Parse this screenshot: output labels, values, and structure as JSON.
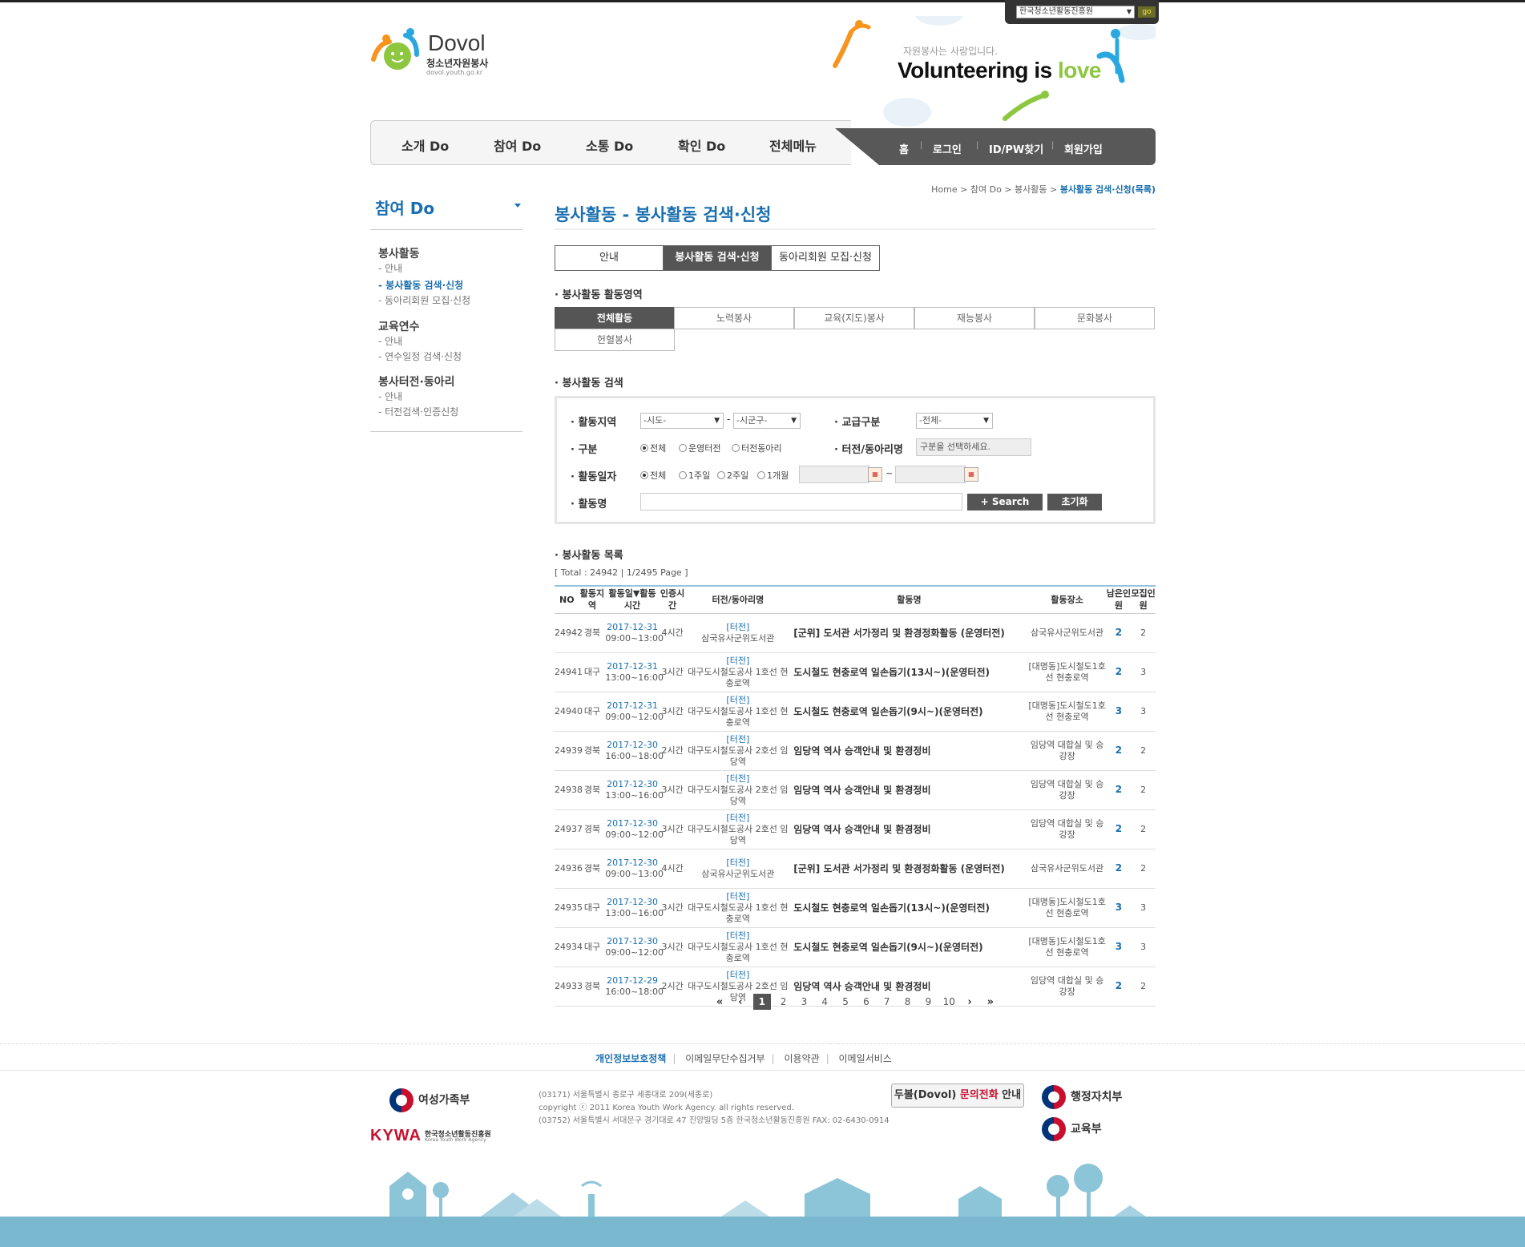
{
  "header": {
    "logo_title": "Dovol",
    "logo_subtitle": "청소년자원봉사",
    "logo_url": "dovol.youth.go.kr",
    "site_select": "한국청소년활동진흥원",
    "go_label": "go",
    "slogan_small": "자원봉사는 사랑입니다.",
    "slogan_main": "Volunteering is ",
    "slogan_love": "love"
  },
  "nav": {
    "items": [
      "소개 Do",
      "참여 Do",
      "소통 Do",
      "확인 Do",
      "전체메뉴"
    ],
    "utils": [
      "홈",
      "로그인",
      "ID/PW찾기",
      "회원가입"
    ]
  },
  "sidebar": {
    "title": "참여 Do",
    "groups": [
      {
        "label": "봉사활동",
        "items": [
          "- 안내",
          "- 봉사활동 검색·신청",
          "- 동아리회원 모집·신청"
        ]
      },
      {
        "label": "교육연수",
        "items": [
          "- 안내",
          "- 연수일정 검색·신청"
        ]
      },
      {
        "label": "봉사터전·동아리",
        "items": [
          "- 안내",
          "- 터전검색·인증신청"
        ]
      }
    ]
  },
  "breadcrumb": {
    "items": [
      "Home",
      "참여 Do",
      "봉사활동"
    ],
    "current": "봉사활동 검색·신청(목록)"
  },
  "page_title": "봉사활동 - 봉사활동 검색·신청",
  "tabs": [
    "안내",
    "봉사활동 검색·신청",
    "동아리회원 모집·신청"
  ],
  "area_section": {
    "title": "봉사활동 활동영역",
    "areas": [
      "전체활동",
      "노력봉사",
      "교육(지도)봉사",
      "재능봉사",
      "문화봉사",
      "헌혈봉사"
    ]
  },
  "search": {
    "title": "봉사활동 검색",
    "region_label": "활동지역",
    "sido": "-시도-",
    "sigungu": "-시군구-",
    "school_label": "교급구분",
    "school_value": "-전체-",
    "type_label": "구분",
    "type_options": [
      "전체",
      "운영터전",
      "터전동아리"
    ],
    "org_label": "터전/동아리명",
    "org_placeholder": "구분을 선택하세요.",
    "date_label": "활동일자",
    "date_options": [
      "전체",
      "1주일",
      "2주일",
      "1개월"
    ],
    "name_label": "활동명",
    "search_button": "+ Search",
    "reset_button": "초기화"
  },
  "list": {
    "title": "봉사활동 목록",
    "total": "[ Total : 24942    |    1/2495 Page ]",
    "headers": {
      "no": "NO",
      "region": "활동지역",
      "date": "활동일▼활동시간",
      "hours": "인증시간",
      "org": "터전/동아리명",
      "name": "활동명",
      "place": "활동장소",
      "remain": "남은인원",
      "recruit": "모집인원"
    },
    "rows": [
      {
        "no": "24942",
        "region": "경북",
        "date": "2017-12-31",
        "time": "09:00~13:00",
        "hours": "4시간",
        "tag": "[터전]",
        "org": "삼국유사군위도서관",
        "name": "[군위] 도서관 서가정리 및 환경정화활동 (운영터전)",
        "place": "삼국유사군위도서관",
        "remain": "2",
        "recruit": "2"
      },
      {
        "no": "24941",
        "region": "대구",
        "date": "2017-12-31",
        "time": "13:00~16:00",
        "hours": "3시간",
        "tag": "[터전]",
        "org": "대구도시철도공사 1호선 현충로역",
        "name": "도시철도 현충로역 일손돕기(13시~)(운영터전)",
        "place": "[대명동]도시철도1호선 현충로역",
        "remain": "2",
        "recruit": "3"
      },
      {
        "no": "24940",
        "region": "대구",
        "date": "2017-12-31",
        "time": "09:00~12:00",
        "hours": "3시간",
        "tag": "[터전]",
        "org": "대구도시철도공사 1호선 현충로역",
        "name": "도시철도 현충로역 일손돕기(9시~)(운영터전)",
        "place": "[대명동]도시철도1호선 현충로역",
        "remain": "3",
        "recruit": "3"
      },
      {
        "no": "24939",
        "region": "경북",
        "date": "2017-12-30",
        "time": "16:00~18:00",
        "hours": "2시간",
        "tag": "[터전]",
        "org": "대구도시철도공사 2호선 임당역",
        "name": "임당역 역사 승객안내 및 환경정비",
        "place": "임당역 대합실 및 승강장",
        "remain": "2",
        "recruit": "2"
      },
      {
        "no": "24938",
        "region": "경북",
        "date": "2017-12-30",
        "time": "13:00~16:00",
        "hours": "3시간",
        "tag": "[터전]",
        "org": "대구도시철도공사 2호선 임당역",
        "name": "임당역 역사 승객안내 및 환경정비",
        "place": "임당역 대합실 및 승강장",
        "remain": "2",
        "recruit": "2"
      },
      {
        "no": "24937",
        "region": "경북",
        "date": "2017-12-30",
        "time": "09:00~12:00",
        "hours": "3시간",
        "tag": "[터전]",
        "org": "대구도시철도공사 2호선 임당역",
        "name": "임당역 역사 승객안내 및 환경정비",
        "place": "임당역 대합실 및 승강장",
        "remain": "2",
        "recruit": "2"
      },
      {
        "no": "24936",
        "region": "경북",
        "date": "2017-12-30",
        "time": "09:00~13:00",
        "hours": "4시간",
        "tag": "[터전]",
        "org": "삼국유사군위도서관",
        "name": "[군위] 도서관 서가정리 및 환경정화활동 (운영터전)",
        "place": "삼국유사군위도서관",
        "remain": "2",
        "recruit": "2"
      },
      {
        "no": "24935",
        "region": "대구",
        "date": "2017-12-30",
        "time": "13:00~16:00",
        "hours": "3시간",
        "tag": "[터전]",
        "org": "대구도시철도공사 1호선 현충로역",
        "name": "도시철도 현충로역 일손돕기(13시~)(운영터전)",
        "place": "[대명동]도시철도1호선 현충로역",
        "remain": "3",
        "recruit": "3"
      },
      {
        "no": "24934",
        "region": "대구",
        "date": "2017-12-30",
        "time": "09:00~12:00",
        "hours": "3시간",
        "tag": "[터전]",
        "org": "대구도시철도공사 1호선 현충로역",
        "name": "도시철도 현충로역 일손돕기(9시~)(운영터전)",
        "place": "[대명동]도시철도1호선 현충로역",
        "remain": "3",
        "recruit": "3"
      },
      {
        "no": "24933",
        "region": "경북",
        "date": "2017-12-29",
        "time": "16:00~18:00",
        "hours": "2시간",
        "tag": "[터전]",
        "org": "대구도시철도공사 2호선 임당역",
        "name": "임당역 역사 승객안내 및 환경정비",
        "place": "임당역 대합실 및 승강장",
        "remain": "2",
        "recruit": "2"
      }
    ]
  },
  "pager": {
    "first": "«",
    "prev": "‹",
    "pages": [
      "1",
      "2",
      "3",
      "4",
      "5",
      "6",
      "7",
      "8",
      "9",
      "10"
    ],
    "current": "1",
    "next": "›",
    "last": "»"
  },
  "footer": {
    "links": [
      "개인정보보호정책",
      "이메일무단수집거부",
      "이용약관",
      "이메일서비스"
    ],
    "ministry1": "여성가족부",
    "kywa": "KYWA",
    "kywa_name": "한국청소년활동진흥원",
    "kywa_en": "Korea Youth Work Agency",
    "address1": "(03171) 서울특별시 종로구 세종대로 209(세종로)",
    "copyright": "copyright ⓒ 2011 Korea Youth Work Agency. all rights reserved.",
    "address2": "(03752) 서울특별시 서대문구 경기대로 47 진양빌딩 5층 한국청소년활동진흥원   FAX: 02-6430-0914",
    "call_prefix": "두볼(Dovol) ",
    "call_red": "문의전화",
    "call_suffix": " 안내",
    "ministry2": "행정자치부",
    "ministry3": "교육부"
  },
  "colors": {
    "accent": "#1a6fb0",
    "dark": "#555555",
    "ground": "#7ab8d0"
  }
}
